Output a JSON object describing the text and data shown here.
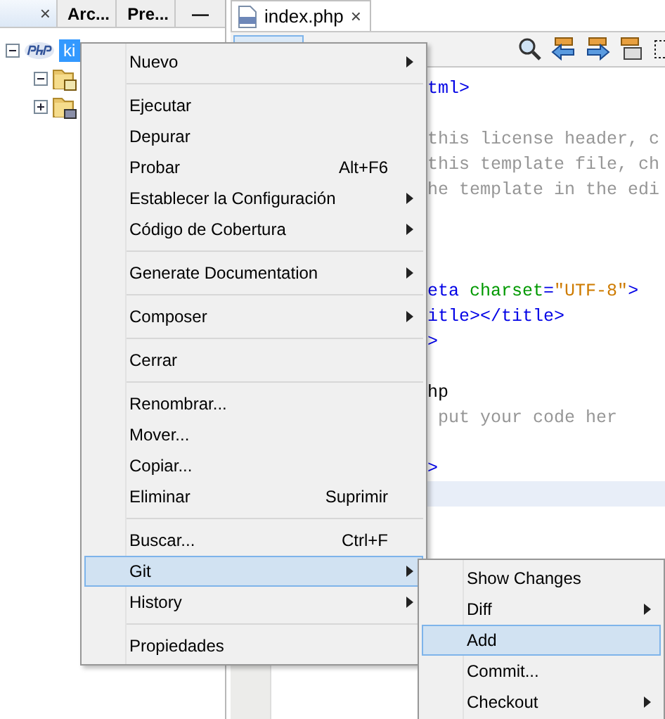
{
  "left_panel": {
    "tabs": [
      {
        "selected": true,
        "close": "×"
      },
      {
        "label": "Arc...",
        "selected": false
      },
      {
        "label": "Pre...",
        "selected": false
      }
    ],
    "minimize": "—",
    "tree": [
      {
        "label": "ki",
        "selected": true,
        "expanded": true,
        "children": [
          {
            "expanded": true
          },
          {
            "expanded": false
          }
        ]
      }
    ]
  },
  "editor": {
    "tab": {
      "label": "index.php",
      "close": "×"
    },
    "toolbar_button": {
      "selected": true
    },
    "lines": [
      {
        "highlighted": false,
        "segments": [
          {
            "kind": "tag",
            "text": "tml>"
          }
        ]
      },
      {
        "highlighted": false
      },
      {
        "highlighted": false,
        "segments": [
          {
            "kind": "comment",
            "text": "this license header, c"
          }
        ]
      },
      {
        "highlighted": false,
        "segments": [
          {
            "kind": "comment",
            "text": "this template file, ch"
          }
        ]
      },
      {
        "highlighted": false,
        "segments": [
          {
            "kind": "comment",
            "text": "he template in the edi"
          }
        ]
      },
      {
        "highlighted": false
      },
      {
        "highlighted": false
      },
      {
        "highlighted": false
      },
      {
        "highlighted": false,
        "segments": [
          {
            "kind": "tag",
            "text": "eta"
          },
          {
            "kind": "attr",
            "text": " charset"
          },
          {
            "kind": "tag",
            "text": "="
          },
          {
            "kind": "string",
            "text": "\"UTF-8\""
          },
          {
            "kind": "tag",
            "text": ">"
          }
        ]
      },
      {
        "highlighted": false,
        "segments": [
          {
            "kind": "tag",
            "text": "itle></title>"
          }
        ]
      },
      {
        "highlighted": false,
        "segments": [
          {
            "kind": "tag",
            "text": ">"
          }
        ]
      },
      {
        "highlighted": false
      },
      {
        "highlighted": false,
        "segments": [
          {
            "kind": "plain",
            "text": "hp"
          }
        ]
      },
      {
        "highlighted": false,
        "segments": [
          {
            "kind": "comment",
            "text": " put your code her"
          }
        ]
      },
      {
        "highlighted": false
      },
      {
        "highlighted": false,
        "segments": [
          {
            "kind": "tag",
            "text": ">"
          }
        ]
      },
      {
        "highlighted": true
      }
    ]
  },
  "context_menu": {
    "items": [
      {
        "kind": "item",
        "label": "Nuevo",
        "submenu": true,
        "selected": false
      },
      {
        "kind": "separator"
      },
      {
        "kind": "item",
        "label": "Ejecutar",
        "submenu": false,
        "selected": false
      },
      {
        "kind": "item",
        "label": "Depurar",
        "submenu": false,
        "selected": false
      },
      {
        "kind": "item",
        "label": "Probar",
        "shortcut": "Alt+F6",
        "submenu": false,
        "selected": false
      },
      {
        "kind": "item",
        "label": "Establecer la Configuración",
        "submenu": true,
        "selected": false
      },
      {
        "kind": "item",
        "label": "Código de Cobertura",
        "submenu": true,
        "selected": false
      },
      {
        "kind": "separator"
      },
      {
        "kind": "item",
        "label": "Generate Documentation",
        "submenu": true,
        "selected": false
      },
      {
        "kind": "separator"
      },
      {
        "kind": "item",
        "label": "Composer",
        "submenu": true,
        "selected": false
      },
      {
        "kind": "separator"
      },
      {
        "kind": "item",
        "label": "Cerrar",
        "submenu": false,
        "selected": false
      },
      {
        "kind": "separator"
      },
      {
        "kind": "item",
        "label": "Renombrar...",
        "submenu": false,
        "selected": false
      },
      {
        "kind": "item",
        "label": "Mover...",
        "submenu": false,
        "selected": false
      },
      {
        "kind": "item",
        "label": "Copiar...",
        "submenu": false,
        "selected": false
      },
      {
        "kind": "item",
        "label": "Eliminar",
        "shortcut": "Suprimir",
        "submenu": false,
        "selected": false
      },
      {
        "kind": "separator"
      },
      {
        "kind": "item",
        "label": "Buscar...",
        "shortcut": "Ctrl+F",
        "submenu": false,
        "selected": false
      },
      {
        "kind": "item",
        "label": "Git",
        "submenu": true,
        "selected": true
      },
      {
        "kind": "item",
        "label": "History",
        "submenu": true,
        "selected": false
      },
      {
        "kind": "separator"
      },
      {
        "kind": "item",
        "label": "Propiedades",
        "submenu": false,
        "selected": false
      }
    ]
  },
  "submenu": {
    "items": [
      {
        "kind": "item",
        "label": "Show Changes",
        "submenu": false,
        "selected": false
      },
      {
        "kind": "item",
        "label": "Diff",
        "submenu": true,
        "selected": false
      },
      {
        "kind": "item",
        "label": "Add",
        "submenu": false,
        "selected": true
      },
      {
        "kind": "item",
        "label": "Commit...",
        "submenu": false,
        "selected": false
      },
      {
        "kind": "item",
        "label": "Checkout",
        "submenu": true,
        "selected": false
      }
    ]
  }
}
